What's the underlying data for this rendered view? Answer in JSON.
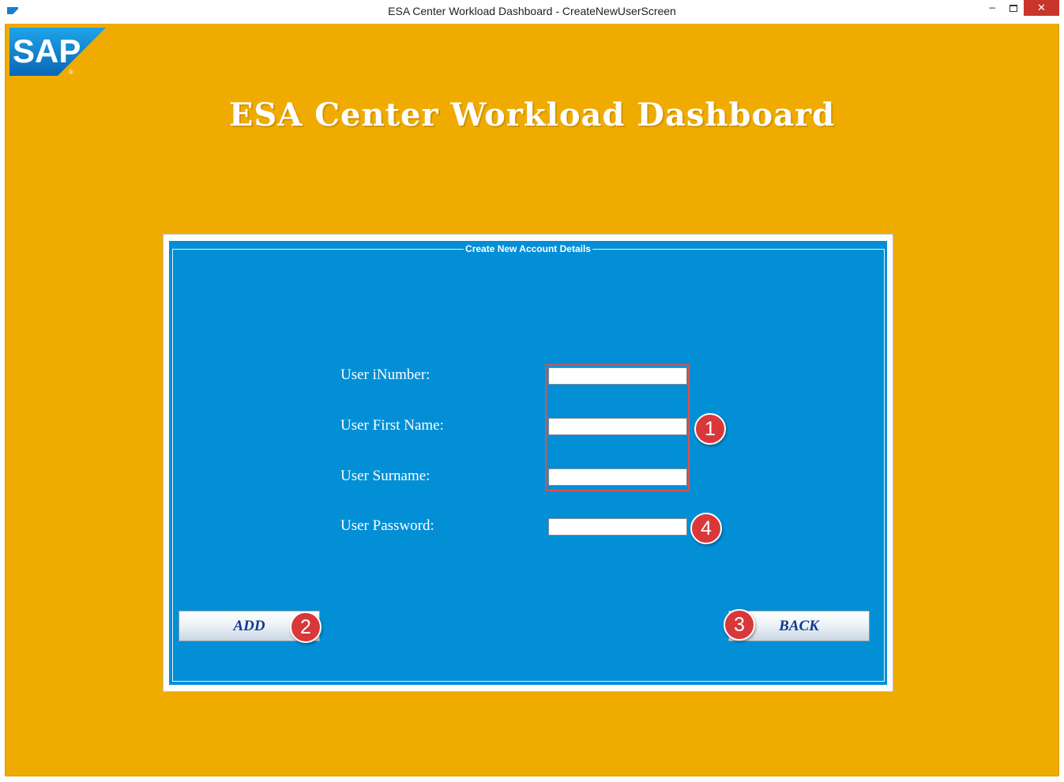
{
  "window": {
    "title": "ESA Center Workload Dashboard - CreateNewUserScreen",
    "minimize_glyph": "−",
    "close_glyph": "✕"
  },
  "logo": {
    "text": "SAP",
    "registered_mark": "®"
  },
  "heading": "ESA Center Workload Dashboard",
  "form": {
    "legend": "Create New Account Details",
    "fields": [
      {
        "label": "User iNumber:",
        "value": ""
      },
      {
        "label": "User First Name:",
        "value": ""
      },
      {
        "label": "User Surname:",
        "value": ""
      },
      {
        "label": "User Password:",
        "value": ""
      }
    ]
  },
  "buttons": {
    "add_label": "ADD",
    "back_label": "BACK"
  },
  "annotations": [
    "1",
    "2",
    "3",
    "4"
  ],
  "colors": {
    "background": "#efab00",
    "panel": "#028fd6",
    "annotation": "#d9383a",
    "button_text": "#103a8c"
  }
}
